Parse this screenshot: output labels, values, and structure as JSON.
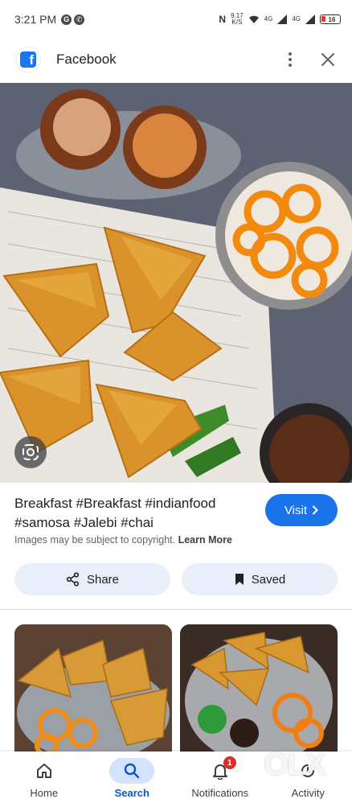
{
  "status_bar": {
    "time": "3:21 PM",
    "notif_icons": [
      "G",
      "W"
    ],
    "net_speed_top": "9.17",
    "net_speed_bottom": "K/S",
    "sim1_label": "Vo WiFi",
    "sim1_signal": "4G",
    "sim2_label": "Vo WiFi",
    "sim2_signal": "4G",
    "battery": "16"
  },
  "header": {
    "app_name": "Facebook",
    "logo_letter": "f"
  },
  "result": {
    "caption": "Breakfast #Breakfast #indianfood #samosa #Jalebi #chai",
    "visit_label": "Visit",
    "copyright_text": "Images may be subject to copyright.",
    "learn_more": "Learn More",
    "share_label": "Share",
    "saved_label": "Saved"
  },
  "bottom_nav": [
    {
      "label": "Home",
      "icon": "home-icon"
    },
    {
      "label": "Search",
      "icon": "search-icon",
      "active": true
    },
    {
      "label": "Notifications",
      "icon": "bell-icon",
      "badge": "1"
    },
    {
      "label": "Activity",
      "icon": "activity-icon"
    }
  ],
  "watermark": "OLX",
  "colors": {
    "accent": "#1a73e8",
    "pill_bg": "#e8effa",
    "facebook_blue": "#1877f2",
    "badge_red": "#d93025"
  }
}
